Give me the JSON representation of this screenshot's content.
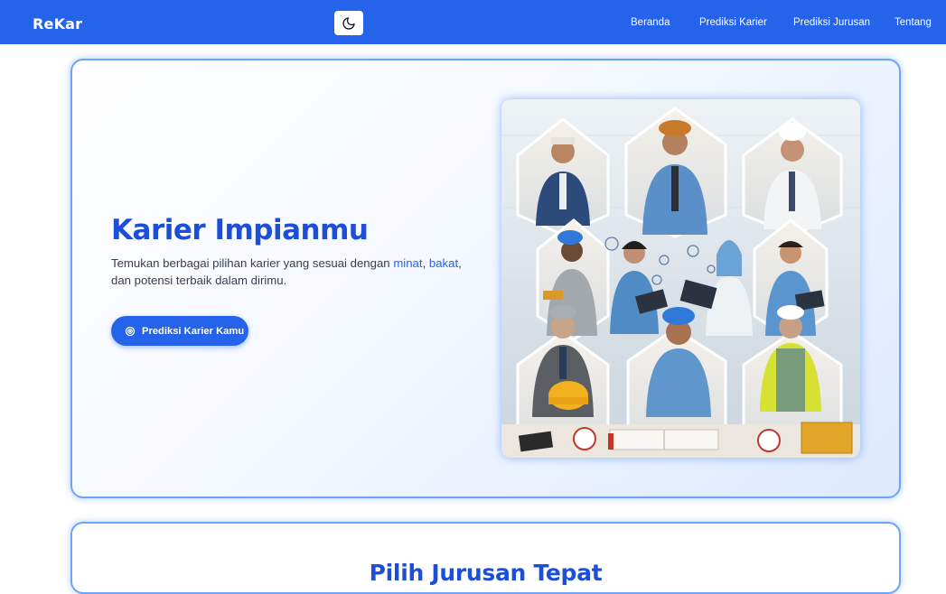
{
  "navbar": {
    "brand": "ReKar",
    "theme_toggle_icon": "moon-icon",
    "links": [
      "Beranda",
      "Prediksi Karier",
      "Prediksi Jurusan",
      "Tentang"
    ],
    "bg_color": "#2563eb"
  },
  "hero": {
    "title": "Karier Impianmu",
    "desc_before": "Temukan berbagai pilihan karier yang sesuai dengan ",
    "desc_hl1": "minat",
    "desc_sep": ", ",
    "desc_hl2": "bakat",
    "desc_after": ", dan potensi terbaik dalam dirimu.",
    "cta_label": "Prediksi Karier Kamu",
    "cta_icon": "target-icon",
    "image_alt": "career-professionals-illustration",
    "accent_color": "#1d4ed8"
  },
  "section2": {
    "title": "Pilih Jurusan Tepat"
  }
}
